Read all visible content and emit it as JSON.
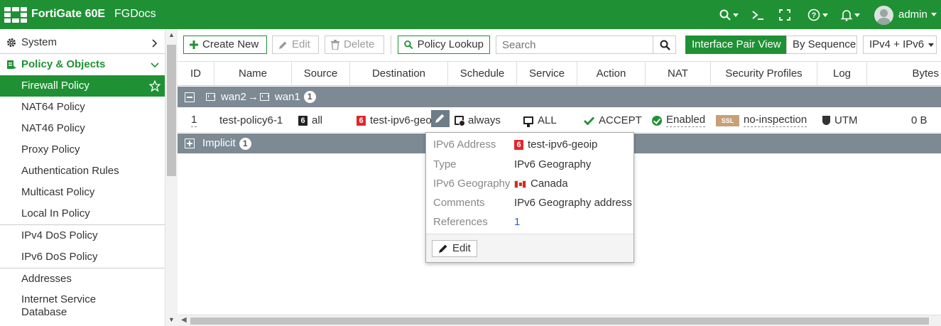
{
  "header": {
    "brand": "FortiGate 60E",
    "hostname": "FGDocs",
    "user": "admin",
    "icons": [
      "search-icon",
      "cli-icon",
      "fullscreen-icon",
      "help-icon",
      "bell-icon"
    ]
  },
  "sidebar": {
    "sections": [
      {
        "label": "System",
        "icon": "gear-icon"
      },
      {
        "label": "Policy & Objects",
        "icon": "policy-icon"
      }
    ],
    "items": [
      {
        "label": "Firewall Policy"
      },
      {
        "label": "NAT64 Policy"
      },
      {
        "label": "NAT46 Policy"
      },
      {
        "label": "Proxy Policy"
      },
      {
        "label": "Authentication Rules"
      },
      {
        "label": "Multicast Policy"
      },
      {
        "label": "Local In Policy"
      },
      {
        "label": "IPv4 DoS Policy"
      },
      {
        "label": "IPv6 DoS Policy"
      },
      {
        "label": "Addresses"
      },
      {
        "label": "Internet Service"
      },
      {
        "label": "Database"
      }
    ]
  },
  "toolbar": {
    "create_new": "Create New",
    "edit": "Edit",
    "delete": "Delete",
    "policy_lookup": "Policy Lookup",
    "search_placeholder": "Search",
    "interface_pair_view": "Interface Pair View",
    "by_sequence": "By Sequence",
    "ip_version": "IPv4 + IPv6"
  },
  "table": {
    "columns": [
      "ID",
      "Name",
      "Source",
      "Destination",
      "Schedule",
      "Service",
      "Action",
      "NAT",
      "Security Profiles",
      "Log",
      "Bytes"
    ],
    "groups": [
      {
        "from": "wan2",
        "arrow": "→",
        "to": "wan1",
        "count": "1"
      },
      {
        "label": "Implicit",
        "count": "1"
      }
    ],
    "rows": [
      {
        "id": "1",
        "name": "test-policy6-1",
        "source": "all",
        "destination": "test-ipv6-geoip",
        "schedule": "always",
        "service": "ALL",
        "action": "ACCEPT",
        "nat": "Enabled",
        "ssl_badge": "SSL",
        "security_profile": "no-inspection",
        "log": "UTM",
        "bytes": "0 B"
      }
    ]
  },
  "tooltip": {
    "rows": [
      {
        "key": "IPv6 Address",
        "value": "test-ipv6-geoip"
      },
      {
        "key": "Type",
        "value": "IPv6 Geography"
      },
      {
        "key": "IPv6 Geography",
        "value": "Canada"
      },
      {
        "key": "Comments",
        "value": "IPv6 Geography address"
      },
      {
        "key": "References",
        "value": "1"
      }
    ],
    "edit_label": "Edit"
  },
  "colors": {
    "brand_green": "#1f9134",
    "group_gray": "#7d8a94",
    "link_blue": "#2d5fb5"
  }
}
